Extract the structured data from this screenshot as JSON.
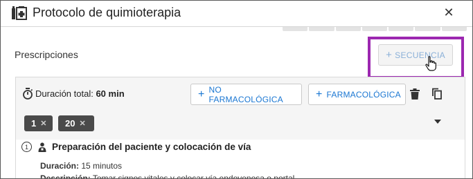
{
  "dialog": {
    "title": "Protocolo de quimioterapia",
    "close_glyph": "✕",
    "title_icon": "medication-icon"
  },
  "prescriptions": {
    "label": "Prescripciones",
    "sequence_button": "SECUENCIA",
    "sequence_button_state": "disabled",
    "highlight_color": "#9c27b0"
  },
  "card": {
    "duration_label": "Duración total:",
    "duration_value": "60 min",
    "buttons": {
      "no_farm": "NO FARMACOLÓGICA",
      "farm": "FARMACOLÓGICA"
    },
    "chips": [
      {
        "label": "1"
      },
      {
        "label": "20"
      }
    ],
    "step": {
      "number": "1",
      "title": "Preparación del paciente y colocación de vía",
      "duration_label": "Duración:",
      "duration_value": "15 minutos",
      "description_label": "Descripción:",
      "description_value": "Tomar signos vitales y colocar vía endovenosa o portal"
    }
  },
  "colors": {
    "accent": "#1976d2",
    "chip_bg": "#4a4a4a"
  }
}
